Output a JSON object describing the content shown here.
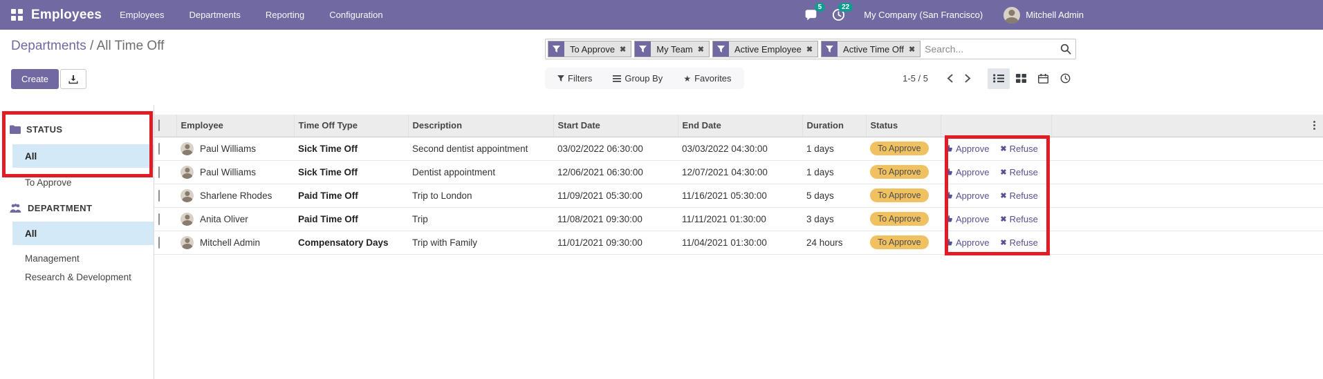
{
  "colors": {
    "brand": "#7169a2",
    "facet-purple": "#7169a2",
    "badge-teal": "#0d9c90",
    "active-item-blue": "#d4e9f7",
    "status-pill-amber": "#f0c161",
    "action-link-purple": "#565191",
    "annotation-red": "#e21c25"
  },
  "navbar": {
    "app_name": "Employees",
    "menu": [
      {
        "label": "Employees"
      },
      {
        "label": "Departments"
      },
      {
        "label": "Reporting"
      },
      {
        "label": "Configuration"
      }
    ],
    "messages_count": "5",
    "activities_count": "22",
    "company": "My Company (San Francisco)",
    "user": "Mitchell Admin"
  },
  "breadcrumb": {
    "parent": "Departments",
    "separator": " / ",
    "current": "All Time Off"
  },
  "actions": {
    "create": "Create"
  },
  "search": {
    "placeholder": "Search...",
    "facets": [
      {
        "label": "To Approve"
      },
      {
        "label": "My Team"
      },
      {
        "label": "Active Employee"
      },
      {
        "label": "Active Time Off"
      }
    ]
  },
  "toolbar": {
    "filters": "Filters",
    "group_by": "Group By",
    "favorites": "Favorites",
    "pager": "1-5 / 5"
  },
  "sidebar": {
    "sections": [
      {
        "title": "STATUS",
        "items": [
          {
            "label": "All"
          },
          {
            "label": "To Approve"
          }
        ]
      },
      {
        "title": "DEPARTMENT",
        "items": [
          {
            "label": "All"
          },
          {
            "label": "Management"
          },
          {
            "label": "Research & Development"
          }
        ]
      }
    ]
  },
  "table": {
    "headers": {
      "employee": "Employee",
      "type": "Time Off Type",
      "description": "Description",
      "start": "Start Date",
      "end": "End Date",
      "duration": "Duration",
      "status": "Status"
    },
    "row_actions": {
      "approve": "Approve",
      "refuse": "Refuse"
    },
    "rows": [
      {
        "employee": "Paul Williams",
        "type": "Sick Time Off",
        "description": "Second dentist appointment",
        "start": "03/02/2022 06:30:00",
        "end": "03/03/2022 04:30:00",
        "duration": "1 days",
        "status": "To Approve"
      },
      {
        "employee": "Paul Williams",
        "type": "Sick Time Off",
        "description": "Dentist appointment",
        "start": "12/06/2021 06:30:00",
        "end": "12/07/2021 04:30:00",
        "duration": "1 days",
        "status": "To Approve"
      },
      {
        "employee": "Sharlene Rhodes",
        "type": "Paid Time Off",
        "description": "Trip to London",
        "start": "11/09/2021 05:30:00",
        "end": "11/16/2021 05:30:00",
        "duration": "5 days",
        "status": "To Approve"
      },
      {
        "employee": "Anita Oliver",
        "type": "Paid Time Off",
        "description": "Trip",
        "start": "11/08/2021 09:30:00",
        "end": "11/11/2021 01:30:00",
        "duration": "3 days",
        "status": "To Approve"
      },
      {
        "employee": "Mitchell Admin",
        "type": "Compensatory Days",
        "description": "Trip with Family",
        "start": "11/01/2021 09:30:00",
        "end": "11/04/2021 01:30:00",
        "duration": "24 hours",
        "status": "To Approve"
      }
    ]
  }
}
